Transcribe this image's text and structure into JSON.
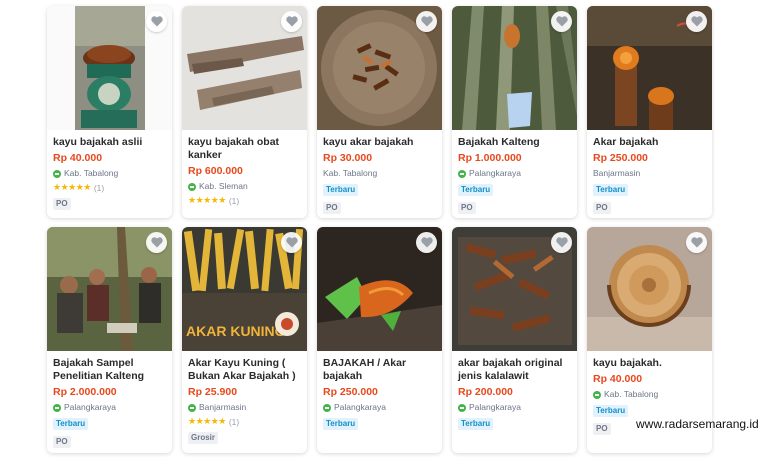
{
  "products": [
    {
      "title": "kayu bajakah aslii",
      "price": "Rp 40.000",
      "location": "Kab. Tabalong",
      "rating_count": "(1)",
      "stars": "★★★★★",
      "tags": [],
      "tag2": "PO"
    },
    {
      "title": "kayu bajakah obat kanker",
      "price": "Rp 600.000",
      "location": "Kab. Sleman",
      "rating_count": "(1)",
      "stars": "★★★★★",
      "tags": [],
      "tag2": ""
    },
    {
      "title": "kayu akar bajakah",
      "price": "Rp 30.000",
      "location": "Kab. Tabalong",
      "tag1": "Terbaru",
      "tag2": "PO"
    },
    {
      "title": "Bajakah Kalteng",
      "price": "Rp 1.000.000",
      "location": "Palangkaraya",
      "tag1": "Terbaru",
      "tag2": "PO"
    },
    {
      "title": "Akar bajakah",
      "price": "Rp 250.000",
      "location": "Banjarmasin",
      "tag1": "Terbaru",
      "tag2": "PO"
    },
    {
      "title": "Bajakah Sampel Penelitian Kalteng",
      "price": "Rp 2.000.000",
      "location": "Palangkaraya",
      "tag1": "Terbaru",
      "tag2": "PO"
    },
    {
      "title": "Akar Kayu Kuning ( Bukan Akar Bajakah )",
      "price": "Rp 25.900",
      "location": "Banjarmasin",
      "rating_count": "(1)",
      "stars": "★★★★★",
      "tag2": "Grosir"
    },
    {
      "title": "BAJAKAH / Akar bajakah",
      "price": "Rp 250.000",
      "location": "Palangkaraya",
      "tag1": "Terbaru"
    },
    {
      "title": "akar bajakah original jenis kalalawit",
      "price": "Rp 200.000",
      "location": "Palangkaraya",
      "tag1": "Terbaru"
    },
    {
      "title": "kayu bajakah.",
      "price": "Rp 40.000",
      "location": "Kab. Tabalong",
      "tag1": "Terbaru",
      "tag2": "PO"
    }
  ],
  "image_text": {
    "akar_kuning": "AKAR KUNING"
  },
  "watermark": "www.radarsemarang.id",
  "colors": {
    "price": "#e8481c",
    "star": "#f6b800",
    "badge_new_bg": "#e1f2fc",
    "badge_new_text": "#1190c9",
    "shop_green": "#42b549"
  }
}
